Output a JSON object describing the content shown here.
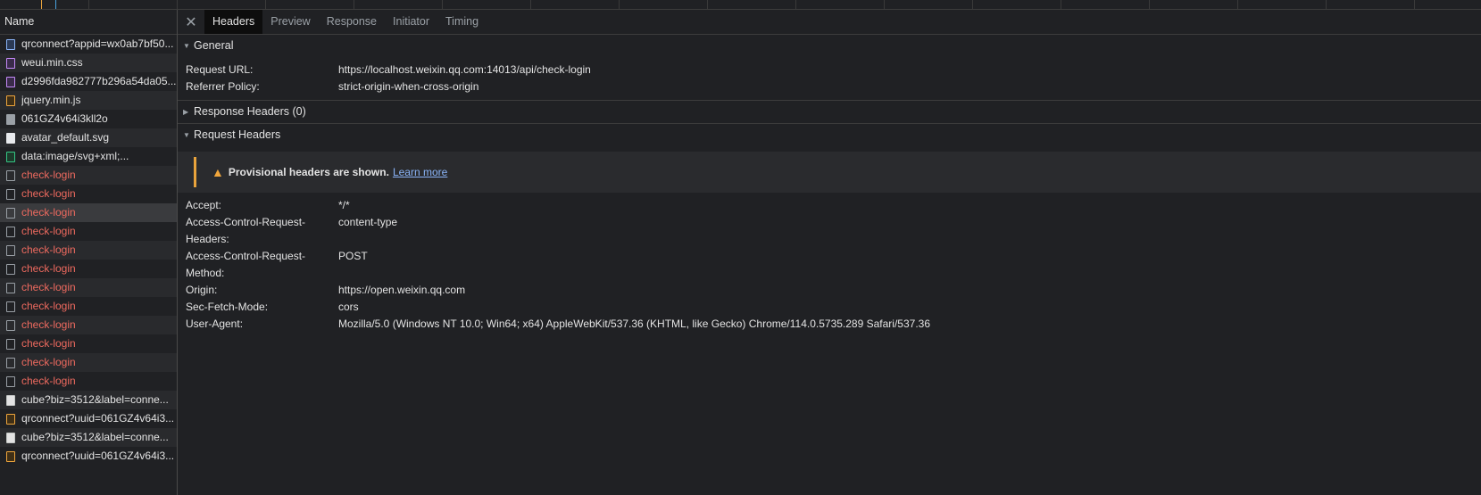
{
  "left": {
    "header": "Name",
    "requests": [
      {
        "name": "qrconnect?appid=wx0ab7bf50...",
        "icon": "doc",
        "error": false
      },
      {
        "name": "weui.min.css",
        "icon": "css",
        "error": false
      },
      {
        "name": "d2996fda982777b296a54da05...",
        "icon": "css",
        "error": false
      },
      {
        "name": "jquery.min.js",
        "icon": "js",
        "error": false
      },
      {
        "name": "061GZ4v64i3kll2o",
        "icon": "img",
        "error": false
      },
      {
        "name": "avatar_default.svg",
        "icon": "imgw",
        "error": false
      },
      {
        "name": "data:image/svg+xml;...",
        "icon": "svgx",
        "error": false
      },
      {
        "name": "check-login",
        "icon": "fail",
        "error": true
      },
      {
        "name": "check-login",
        "icon": "fail",
        "error": true
      },
      {
        "name": "check-login",
        "icon": "fail",
        "error": true
      },
      {
        "name": "check-login",
        "icon": "fail",
        "error": true
      },
      {
        "name": "check-login",
        "icon": "fail",
        "error": true
      },
      {
        "name": "check-login",
        "icon": "fail",
        "error": true
      },
      {
        "name": "check-login",
        "icon": "fail",
        "error": true
      },
      {
        "name": "check-login",
        "icon": "fail",
        "error": true
      },
      {
        "name": "check-login",
        "icon": "fail",
        "error": true
      },
      {
        "name": "check-login",
        "icon": "fail",
        "error": true
      },
      {
        "name": "check-login",
        "icon": "fail",
        "error": true
      },
      {
        "name": "check-login",
        "icon": "fail",
        "error": true
      },
      {
        "name": "cube?biz=3512&label=conne...",
        "icon": "plain",
        "error": false
      },
      {
        "name": "qrconnect?uuid=061GZ4v64i3...",
        "icon": "js",
        "error": false
      },
      {
        "name": "cube?biz=3512&label=conne...",
        "icon": "plain",
        "error": false
      },
      {
        "name": "qrconnect?uuid=061GZ4v64i3...",
        "icon": "js",
        "error": false
      }
    ],
    "selected_index": 9
  },
  "tabs": {
    "close_icon": "close-icon",
    "items": [
      "Headers",
      "Preview",
      "Response",
      "Initiator",
      "Timing"
    ],
    "active": "Headers"
  },
  "general": {
    "title": "General",
    "rows": [
      {
        "k": "Request URL:",
        "v": "https://localhost.weixin.qq.com:14013/api/check-login"
      },
      {
        "k": "Referrer Policy:",
        "v": "strict-origin-when-cross-origin"
      }
    ]
  },
  "response_headers": {
    "title": "Response Headers (0)"
  },
  "request_headers": {
    "title": "Request Headers",
    "warning": {
      "icon": "warning-icon",
      "text": "Provisional headers are shown.",
      "link": "Learn more"
    },
    "rows": [
      {
        "k": "Accept:",
        "k2": "",
        "v": "*/*"
      },
      {
        "k": "Access-Control-Request-",
        "k2": "Headers:",
        "v": "content-type"
      },
      {
        "k": "Access-Control-Request-",
        "k2": "Method:",
        "v": "POST"
      },
      {
        "k": "Origin:",
        "k2": "",
        "v": "https://open.weixin.qq.com"
      },
      {
        "k": "Sec-Fetch-Mode:",
        "k2": "",
        "v": "cors"
      },
      {
        "k": "User-Agent:",
        "k2": "",
        "v": "Mozilla/5.0 (Windows NT 10.0; Win64; x64) AppleWebKit/537.36 (KHTML, like Gecko) Chrome/114.0.5735.289 Safari/537.36"
      }
    ]
  },
  "colors": {
    "error": "#ee6a5f",
    "link": "#8ab4f8",
    "warning": "#e8a33c",
    "background": "#202124"
  }
}
